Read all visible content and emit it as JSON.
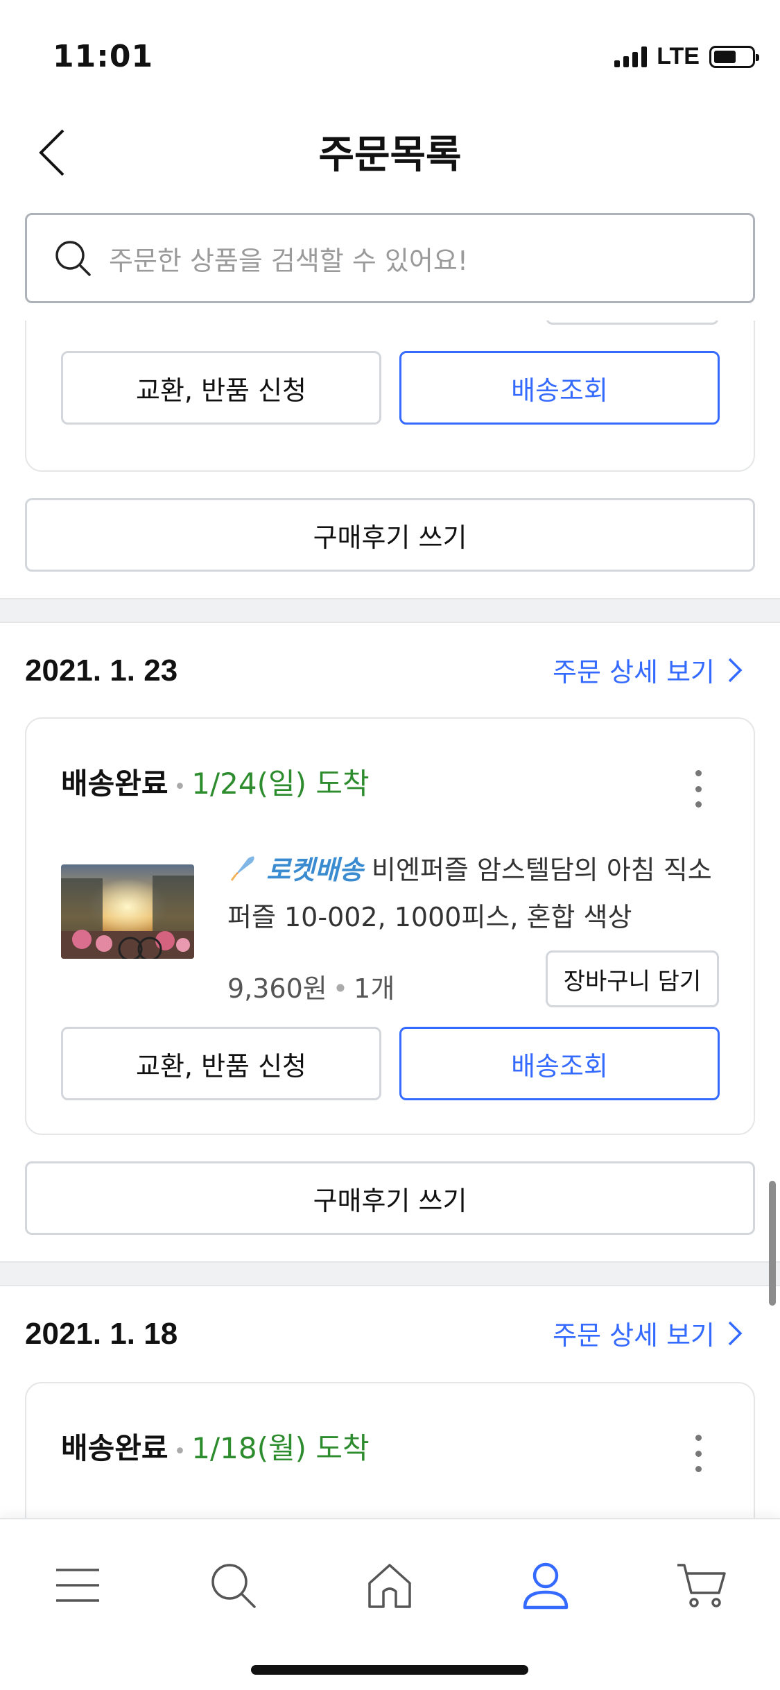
{
  "status_bar": {
    "time": "11:01",
    "network": "LTE"
  },
  "header": {
    "title": "주문목록"
  },
  "search": {
    "placeholder": "주문한 상품을 검색할 수 있어요!"
  },
  "orders": [
    {
      "buttons": {
        "exchange": "교환, 반품 신청",
        "tracking": "배송조회"
      },
      "review": "구매후기 쓰기"
    },
    {
      "date": "2021. 1. 23",
      "detail_link": "주문 상세 보기",
      "status": "배송완료",
      "arrival": "1/24(일) 도착",
      "product": {
        "badge": "로켓배송",
        "name": "비엔퍼즐 암스텔담의 아침 직소퍼즐 10-002, 1000피스, 혼합 색상",
        "price": "9,360원",
        "quantity": "1개",
        "cart_label": "장바구니 담기"
      },
      "buttons": {
        "exchange": "교환, 반품 신청",
        "tracking": "배송조회"
      },
      "review": "구매후기 쓰기"
    },
    {
      "date": "2021. 1. 18",
      "detail_link": "주문 상세 보기",
      "status": "배송완료",
      "arrival": "1/18(월) 도착"
    }
  ],
  "tab_bar": {
    "items": [
      "menu-icon",
      "search-icon",
      "home-icon",
      "user-icon",
      "cart-icon"
    ],
    "active": "user-icon"
  },
  "colors": {
    "accent": "#346aff",
    "arrival_green": "#2d8c2d",
    "rocket_blue": "#3a8bd0"
  }
}
